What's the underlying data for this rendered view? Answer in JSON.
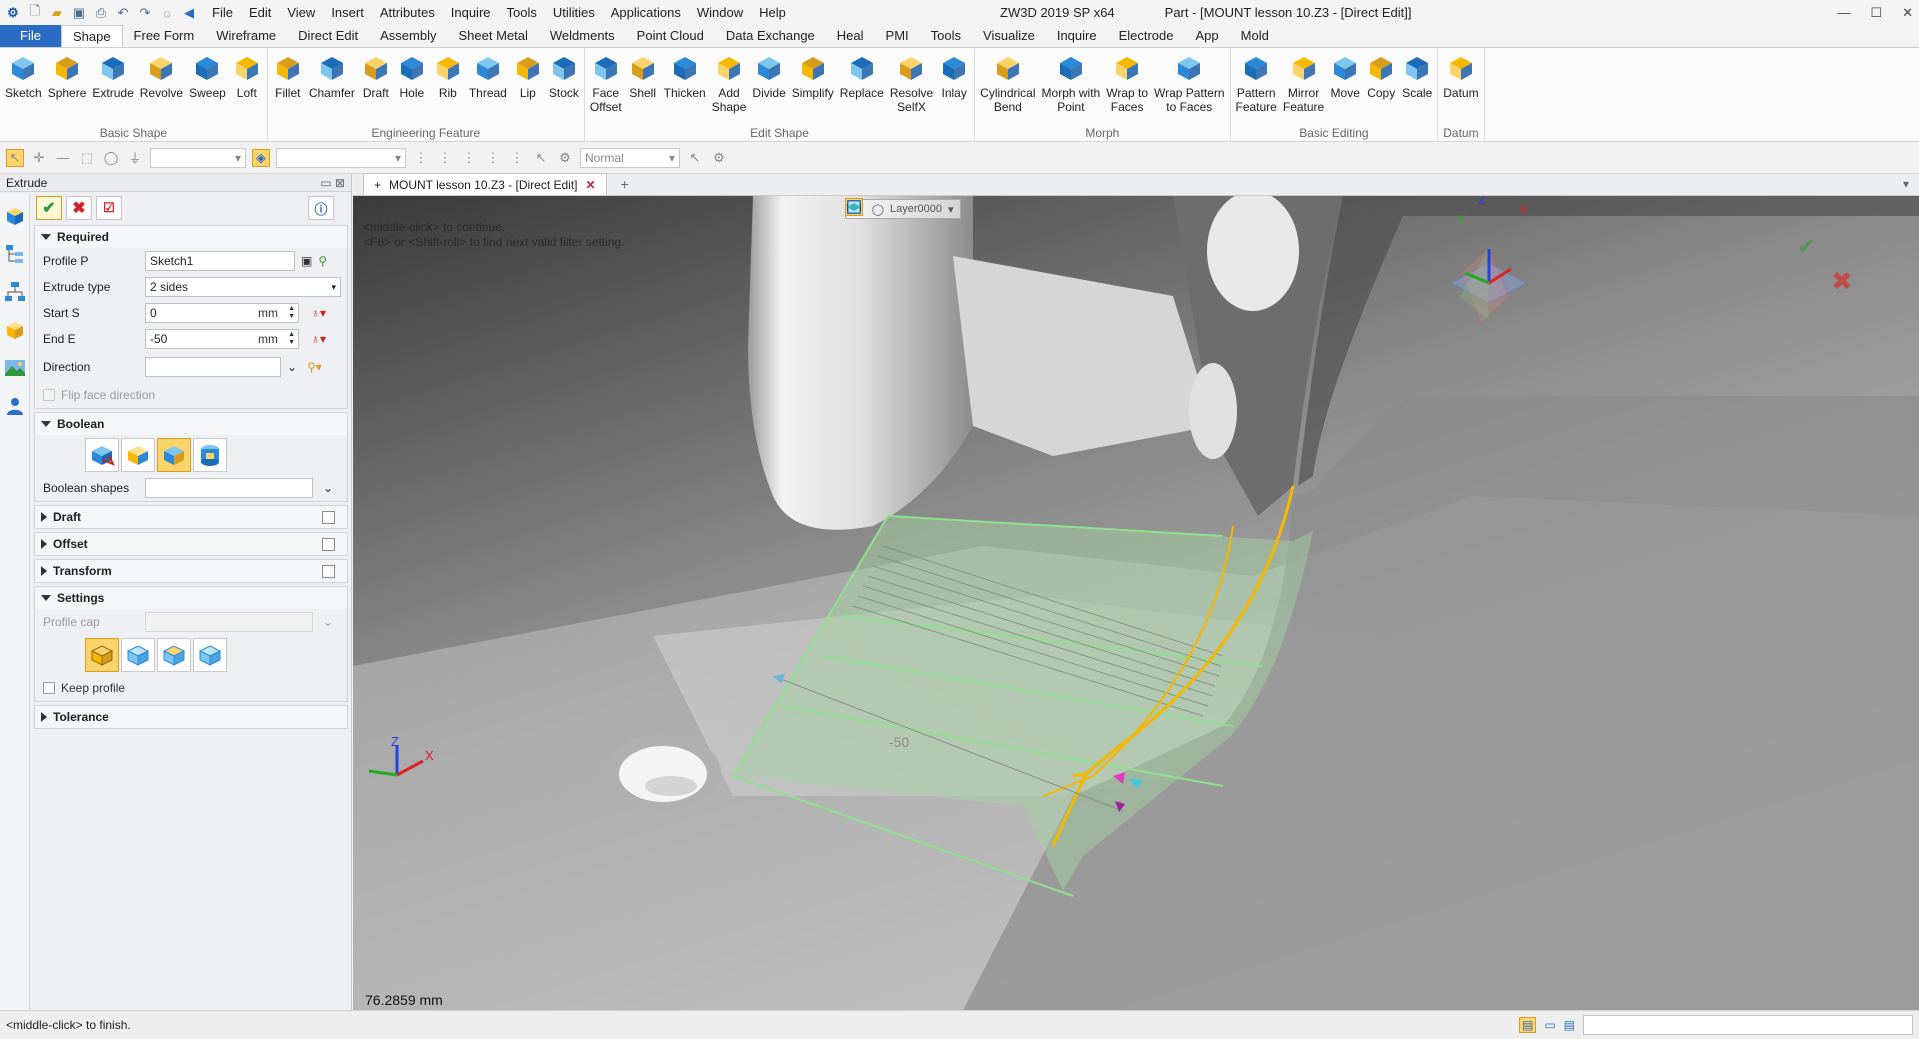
{
  "window": {
    "app_title": "ZW3D 2019 SP x64",
    "doc_title": "Part - [MOUNT lesson 10.Z3 - [Direct Edit]]"
  },
  "menu": [
    "File",
    "Edit",
    "View",
    "Insert",
    "Attributes",
    "Inquire",
    "Tools",
    "Utilities",
    "Applications",
    "Window",
    "Help"
  ],
  "ribbon_tabs": [
    "File",
    "Shape",
    "Free Form",
    "Wireframe",
    "Direct Edit",
    "Assembly",
    "Sheet Metal",
    "Weldments",
    "Point Cloud",
    "Data Exchange",
    "Heal",
    "PMI",
    "Tools",
    "Visualize",
    "Inquire",
    "Electrode",
    "App",
    "Mold"
  ],
  "ribbon_groups": [
    {
      "label": "Basic Shape",
      "buttons": [
        {
          "label": "Sketch",
          "icon": "sketch-icon"
        },
        {
          "label": "Sphere",
          "icon": "sphere-icon"
        },
        {
          "label": "Extrude",
          "icon": "extrude-icon"
        },
        {
          "label": "Revolve",
          "icon": "revolve-icon"
        },
        {
          "label": "Sweep",
          "icon": "sweep-icon"
        },
        {
          "label": "Loft",
          "icon": "loft-icon"
        }
      ]
    },
    {
      "label": "Engineering Feature",
      "buttons": [
        {
          "label": "Fillet",
          "icon": "fillet-icon"
        },
        {
          "label": "Chamfer",
          "icon": "chamfer-icon"
        },
        {
          "label": "Draft",
          "icon": "draft-icon"
        },
        {
          "label": "Hole",
          "icon": "hole-icon"
        },
        {
          "label": "Rib",
          "icon": "rib-icon"
        },
        {
          "label": "Thread",
          "icon": "thread-icon"
        },
        {
          "label": "Lip",
          "icon": "lip-icon"
        },
        {
          "label": "Stock",
          "icon": "stock-icon"
        }
      ]
    },
    {
      "label": "Edit Shape",
      "buttons": [
        {
          "label": "Face\nOffset",
          "icon": "face-offset-icon"
        },
        {
          "label": "Shell",
          "icon": "shell-icon"
        },
        {
          "label": "Thicken",
          "icon": "thicken-icon"
        },
        {
          "label": "Add\nShape",
          "icon": "add-shape-icon"
        },
        {
          "label": "Divide",
          "icon": "divide-icon"
        },
        {
          "label": "Simplify",
          "icon": "simplify-icon"
        },
        {
          "label": "Replace",
          "icon": "replace-icon"
        },
        {
          "label": "Resolve\nSelfX",
          "icon": "resolve-selfx-icon"
        },
        {
          "label": "Inlay",
          "icon": "inlay-icon"
        }
      ]
    },
    {
      "label": "Morph",
      "buttons": [
        {
          "label": "Cylindrical\nBend",
          "icon": "cylindrical-bend-icon"
        },
        {
          "label": "Morph with\nPoint",
          "icon": "morph-point-icon"
        },
        {
          "label": "Wrap to\nFaces",
          "icon": "wrap-faces-icon"
        },
        {
          "label": "Wrap Pattern\nto Faces",
          "icon": "wrap-pattern-icon"
        }
      ]
    },
    {
      "label": "Basic Editing",
      "buttons": [
        {
          "label": "Pattern\nFeature",
          "icon": "pattern-feature-icon"
        },
        {
          "label": "Mirror\nFeature",
          "icon": "mirror-feature-icon"
        },
        {
          "label": "Move",
          "icon": "move-icon"
        },
        {
          "label": "Copy",
          "icon": "copy-icon"
        },
        {
          "label": "Scale",
          "icon": "scale-icon"
        }
      ]
    },
    {
      "label": "Datum",
      "buttons": [
        {
          "label": "Datum",
          "icon": "datum-icon"
        }
      ]
    }
  ],
  "toolbar2": {
    "render_mode": "Normal"
  },
  "panel": {
    "title": "Extrude",
    "required": {
      "header": "Required",
      "profile_label": "Profile P",
      "profile_value": "Sketch1",
      "extrude_type_label": "Extrude type",
      "extrude_type_value": "2 sides",
      "start_label": "Start S",
      "start_value": "0",
      "start_unit": "mm",
      "end_label": "End E",
      "end_value": "-50",
      "end_unit": "mm",
      "direction_label": "Direction",
      "direction_value": "",
      "flip_label": "Flip face direction"
    },
    "boolean": {
      "header": "Boolean",
      "shapes_label": "Boolean shapes",
      "selected_index": 2
    },
    "draft": {
      "header": "Draft"
    },
    "offset": {
      "header": "Offset"
    },
    "transform": {
      "header": "Transform"
    },
    "settings": {
      "header": "Settings",
      "profile_cap_label": "Profile cap",
      "keep_profile_label": "Keep profile",
      "selected_index": 0
    },
    "tolerance": {
      "header": "Tolerance"
    }
  },
  "doc_tab": {
    "label": "MOUNT lesson 10.Z3 - [Direct Edit]"
  },
  "viewport": {
    "layer": "Layer0000",
    "message_line1": "<middle-click> to continue.",
    "message_line2": "<F8> or <Shift-roll> to find next valid filter setting.",
    "measure": "76.2859 mm",
    "dimension": "-50",
    "axis_x": "X",
    "axis_y": "Y",
    "axis_z": "Z"
  },
  "status": {
    "message": "<middle-click> to finish."
  },
  "colors": {
    "accent_blue": "#2b6cc4",
    "selection_yellow": "#f5b700",
    "preview_green": "#8fe08f"
  }
}
